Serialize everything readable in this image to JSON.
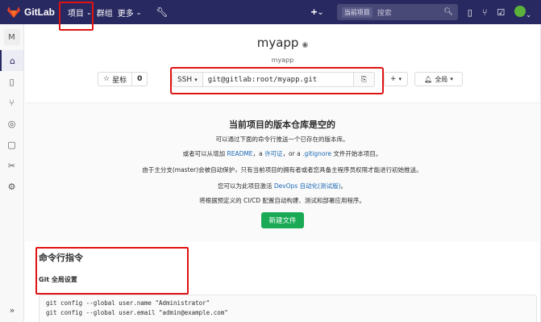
{
  "topnav": {
    "brand": "GitLab",
    "projects_label": "项目",
    "groups_label": "群组",
    "more_label": "更多",
    "search_scope": "当前项目",
    "search_placeholder": "搜索"
  },
  "sidebar": {
    "avatar_letter": "M",
    "items": [
      "home-icon",
      "repository-icon",
      "merge-request-icon",
      "ci-cd-icon",
      "issues-icon",
      "snippets-icon",
      "settings-icon"
    ],
    "collapse": "»"
  },
  "project": {
    "name": "myapp",
    "path": "myapp",
    "star_label": "星标",
    "star_count": "0",
    "protocol": "SSH",
    "clone_url": "git@gitlab:root/myapp.git",
    "notification_label": "全局"
  },
  "empty_repo": {
    "title": "当前项目的版本仓库是空的",
    "line1": "可以通过下面的命令行推送一个已存在的版本库。",
    "line2_pre": "或者可以从增加",
    "line2_readme": "README",
    "line2_mid1": "，a",
    "line2_license": "许可证",
    "line2_mid2": "，or a",
    "line2_gitignore": ".gitignore",
    "line2_post": "文件开始本项目。",
    "line3": "由于主分支(master)会被自动保护，只有当前项目的拥有者或者您具备主程序员权限才能进行初始推送。",
    "line4_pre": "您可以为此项目激活",
    "line4_link": "DevOps 自动化(测试版)",
    "line4_post": "。",
    "line5": "将根据预定义的 CI/CD 配置自动构建、测试和部署应用程序。",
    "new_file_button": "新建文件"
  },
  "cli": {
    "title": "命令行指令",
    "git_setup_title": "Git 全局设置",
    "code_lines": [
      "git config --global user.name \"Administrator\"",
      "git config --global user.email \"admin@example.com\""
    ]
  },
  "colors": {
    "nav_bg": "#292961",
    "accent_green": "#1aaa55",
    "link": "#1b69b6",
    "highlight": "#e01313"
  }
}
